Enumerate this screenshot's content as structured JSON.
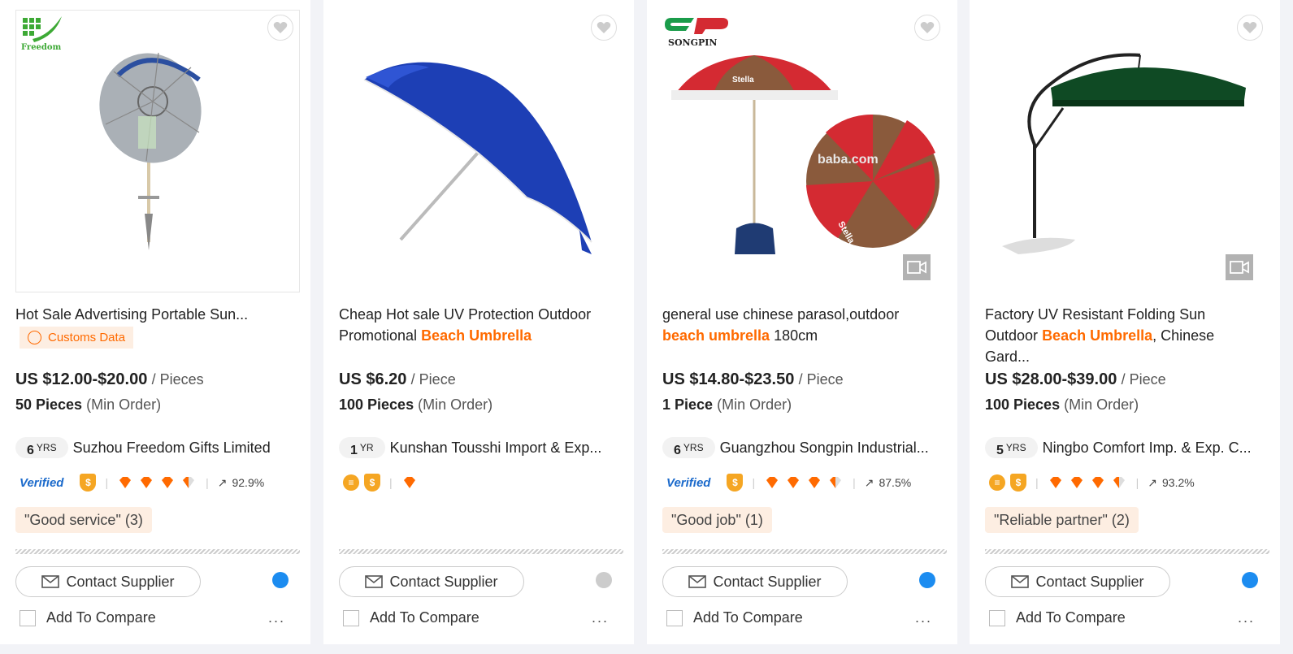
{
  "products": [
    {
      "title_plain": "Hot Sale Advertising Portable Sun...",
      "title_highlight": "",
      "title_after": "",
      "customs": "Customs Data",
      "price": "US $12.00-$20.00",
      "price_unit": "/ Pieces",
      "moq": "50 Pieces",
      "moq_suffix": "(Min Order)",
      "years": "6",
      "years_unit": "YRS",
      "supplier": "Suzhou Freedom Gifts Limited",
      "verified": "Verified",
      "rate": "92.9%",
      "review": "\"Good service\" (3)",
      "contact": "Contact Supplier",
      "compare": "Add To Compare",
      "more": "...",
      "logo_text": "Freedom",
      "umbrella_color": "#aab0b6"
    },
    {
      "title_plain": "Cheap Hot sale UV Protection Outdoor Promotional",
      "title_highlight": "Beach Umbrella",
      "title_after": "",
      "price": "US $6.20",
      "price_unit": "/ Piece",
      "moq": "100 Pieces",
      "moq_suffix": "(Min Order)",
      "years": "1",
      "years_unit": "YR",
      "supplier": "Kunshan Tousshi Import & Exp...",
      "contact": "Contact Supplier",
      "compare": "Add To Compare",
      "more": "...",
      "umbrella_color": "#1d3fb5"
    },
    {
      "title_plain": "general use chinese parasol,outdoor",
      "title_highlight": "beach umbrella",
      "title_after": "180cm",
      "price": "US $14.80-$23.50",
      "price_unit": "/ Piece",
      "moq": "1 Piece",
      "moq_suffix": "(Min Order)",
      "years": "6",
      "years_unit": "YRS",
      "supplier": "Guangzhou Songpin Industrial...",
      "verified": "Verified",
      "rate": "87.5%",
      "review": "\"Good job\" (1)",
      "contact": "Contact Supplier",
      "compare": "Add To Compare",
      "more": "...",
      "logo_text": "SONGPIN",
      "watermark": "baba.com",
      "canopy_text": "Stella",
      "umbrella_color": "#d42a32"
    },
    {
      "title_plain": "Factory UV Resistant Folding Sun Outdoor",
      "title_highlight": "Beach Umbrella",
      "title_after": ", Chinese Gard...",
      "price": "US $28.00-$39.00",
      "price_unit": "/ Piece",
      "moq": "100 Pieces",
      "moq_suffix": "(Min Order)",
      "years": "5",
      "years_unit": "YRS",
      "supplier": "Ningbo Comfort Imp. & Exp. C...",
      "rate": "93.2%",
      "review": "\"Reliable partner\" (2)",
      "contact": "Contact Supplier",
      "compare": "Add To Compare",
      "more": "...",
      "umbrella_color": "#0f4a24"
    }
  ],
  "colors": {
    "accent": "#ff6a00",
    "verified": "#1b6acb",
    "diamond": "#ff6a00",
    "chat": "#1c8cf0"
  }
}
